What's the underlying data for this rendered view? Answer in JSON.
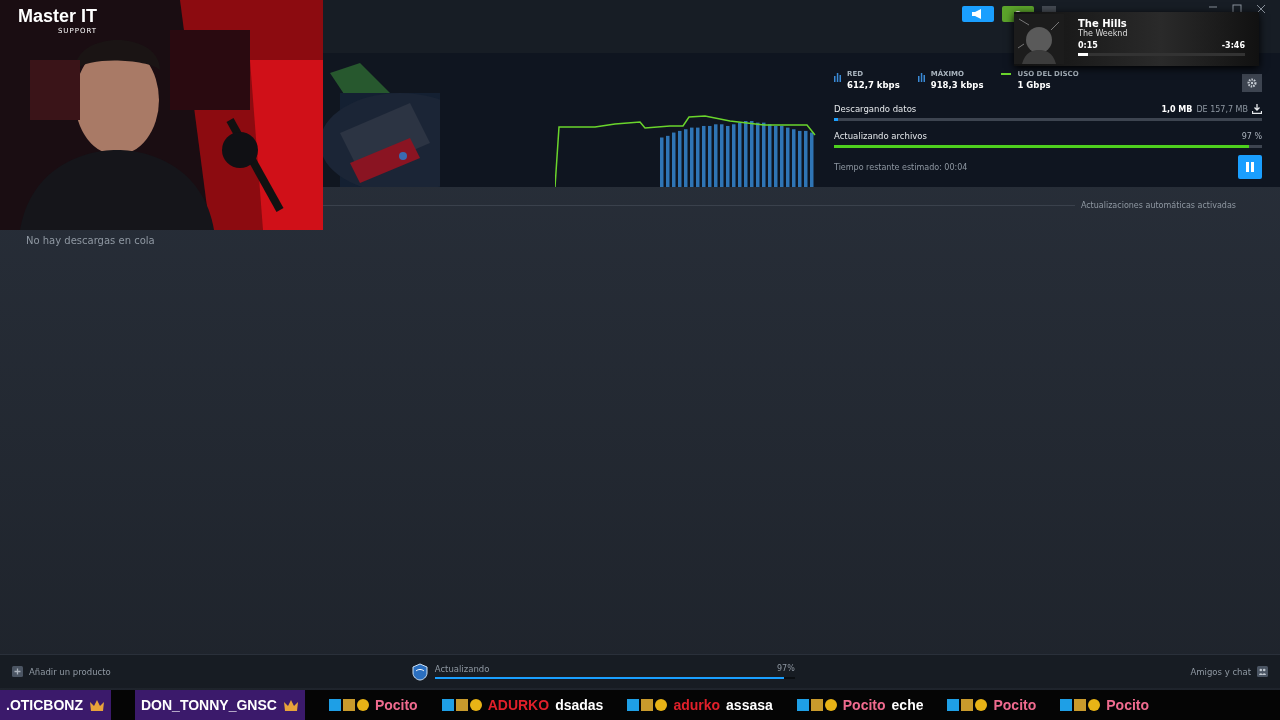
{
  "overlay": {
    "logo": "Master IT",
    "logo_sub": "SUPPORT"
  },
  "stats": [
    {
      "label": "RED",
      "value": "612,7 kbps",
      "kind": "bars"
    },
    {
      "label": "MÁXIMO",
      "value": "918,3 kbps",
      "kind": "bars"
    },
    {
      "label": "USO DEL DISCO",
      "value": "1 Gbps",
      "kind": "line"
    }
  ],
  "download": {
    "label": "Descargando datos",
    "amount": "1,0 MB",
    "of": "DE 157,7 MB",
    "level": 0.01
  },
  "update": {
    "label": "Actualizando archivos",
    "percent": "97 %",
    "level": 0.97
  },
  "remaining": "Tiempo restante estimado: 00:04",
  "auto_updates": "Actualizaciones automáticas activadas",
  "queue_empty": "No hay descargas en cola",
  "music": {
    "title": "The Hills",
    "artist": "The Weeknd",
    "elapsed": "0:15",
    "remaining": "-3:46",
    "level": 0.06
  },
  "footer": {
    "add": "Añadir un producto",
    "status": "Actualizando",
    "percent": "97%",
    "level": 0.97,
    "friends": "Amigos y chat"
  },
  "ticker": [
    {
      "kind": "sub",
      "user": ".OTICBONZ",
      "color": "#ffffff"
    },
    {
      "kind": "sub",
      "user": "DON_TONNY_GNSC",
      "color": "#ffffff"
    },
    {
      "kind": "chat",
      "user": "Pocito",
      "color": "#f06b8f"
    },
    {
      "kind": "chat",
      "user": "ADURKO",
      "color": "#e0202a",
      "message": "dsadas"
    },
    {
      "kind": "chat",
      "user": "adurko",
      "color": "#e0202a",
      "message": "assasa"
    },
    {
      "kind": "chat",
      "user": "Pocito",
      "color": "#f06b8f",
      "message": "eche"
    },
    {
      "kind": "chat",
      "user": "Pocito",
      "color": "#f06b8f"
    },
    {
      "kind": "chat",
      "user": "Pocito",
      "color": "#f06b8f"
    }
  ]
}
